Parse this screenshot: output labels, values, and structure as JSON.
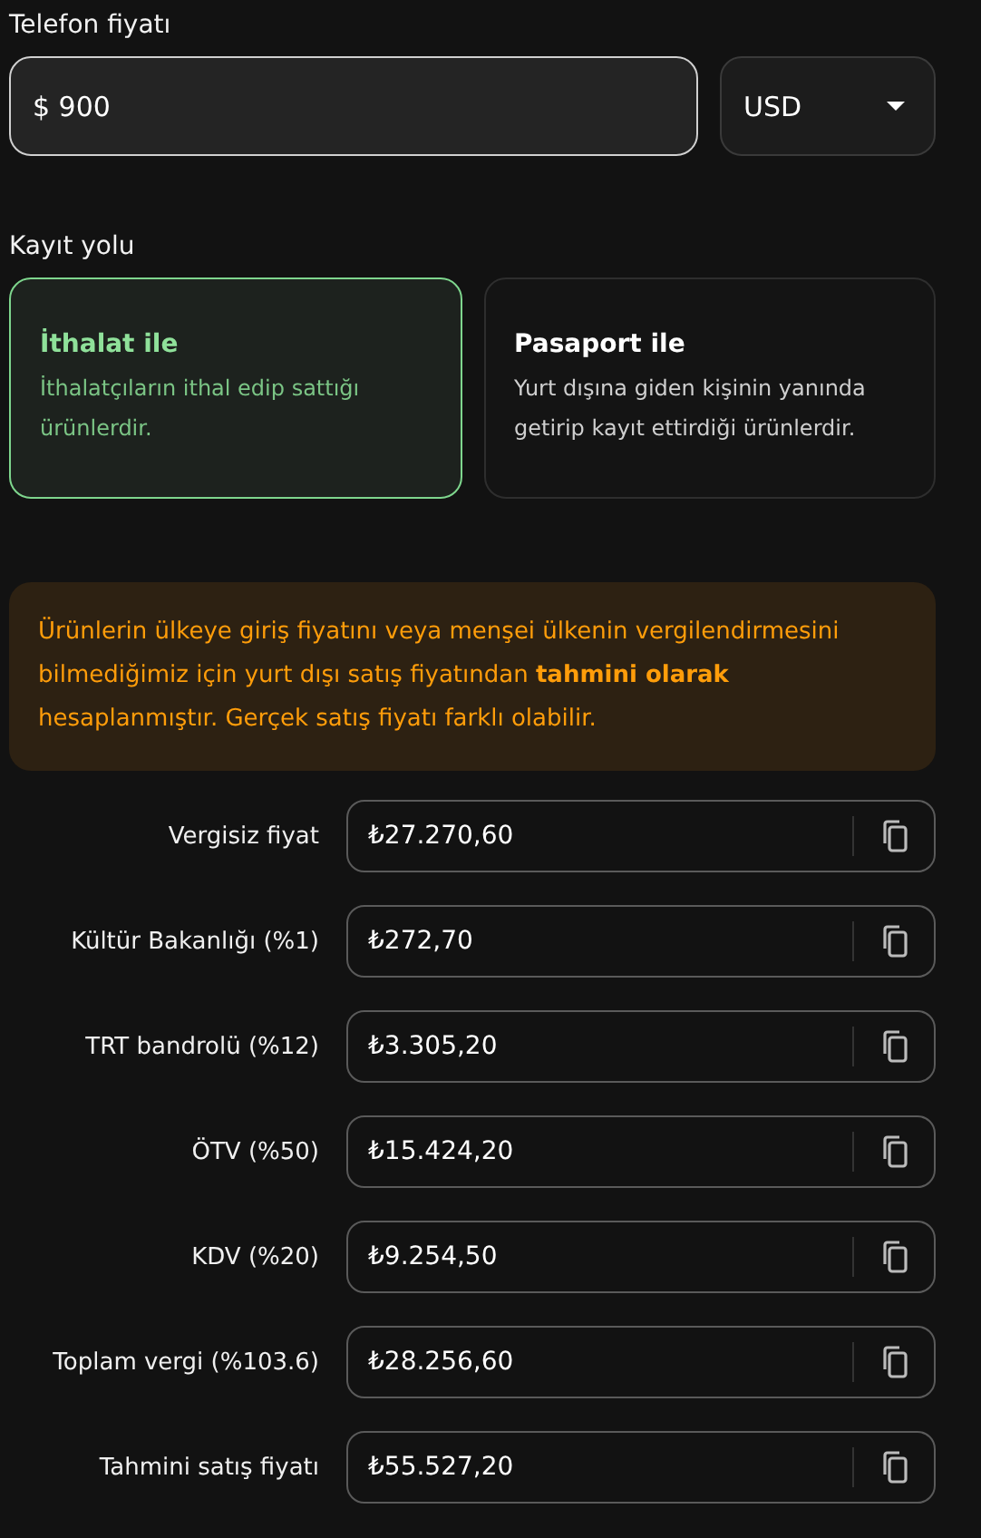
{
  "price": {
    "label": "Telefon fiyatı",
    "value": "$ 900",
    "currency": "USD"
  },
  "registration": {
    "label": "Kayıt yolu",
    "options": [
      {
        "title": "İthalat ile",
        "description": "İthalatçıların ithal edip sattığı ürünlerdir.",
        "selected": true
      },
      {
        "title": "Pasaport ile",
        "description": "Yurt dışına giden kişinin yanında getirip kayıt ettirdiği ürünlerdir.",
        "selected": false
      }
    ]
  },
  "notice": "Ürünlerin ülkeye giriş fiyatını veya menşei ülkenin vergilendirmesini bilmediğimiz için yurt dışı satış fiyatından **tahmini olarak** hesaplanmıştır. Gerçek satış fiyatı farklı olabilir.",
  "results": [
    {
      "label": "Vergisiz fiyat",
      "value": "₺27.270,60"
    },
    {
      "label": "Kültür Bakanlığı (%1)",
      "value": "₺272,70"
    },
    {
      "label": "TRT bandrolü (%12)",
      "value": "₺3.305,20"
    },
    {
      "label": "ÖTV (%50)",
      "value": "₺15.424,20"
    },
    {
      "label": "KDV (%20)",
      "value": "₺9.254,50"
    },
    {
      "label": "Toplam vergi (%103.6)",
      "value": "₺28.256,60"
    },
    {
      "label": "Tahmini satış fiyatı",
      "value": "₺55.527,20"
    }
  ]
}
